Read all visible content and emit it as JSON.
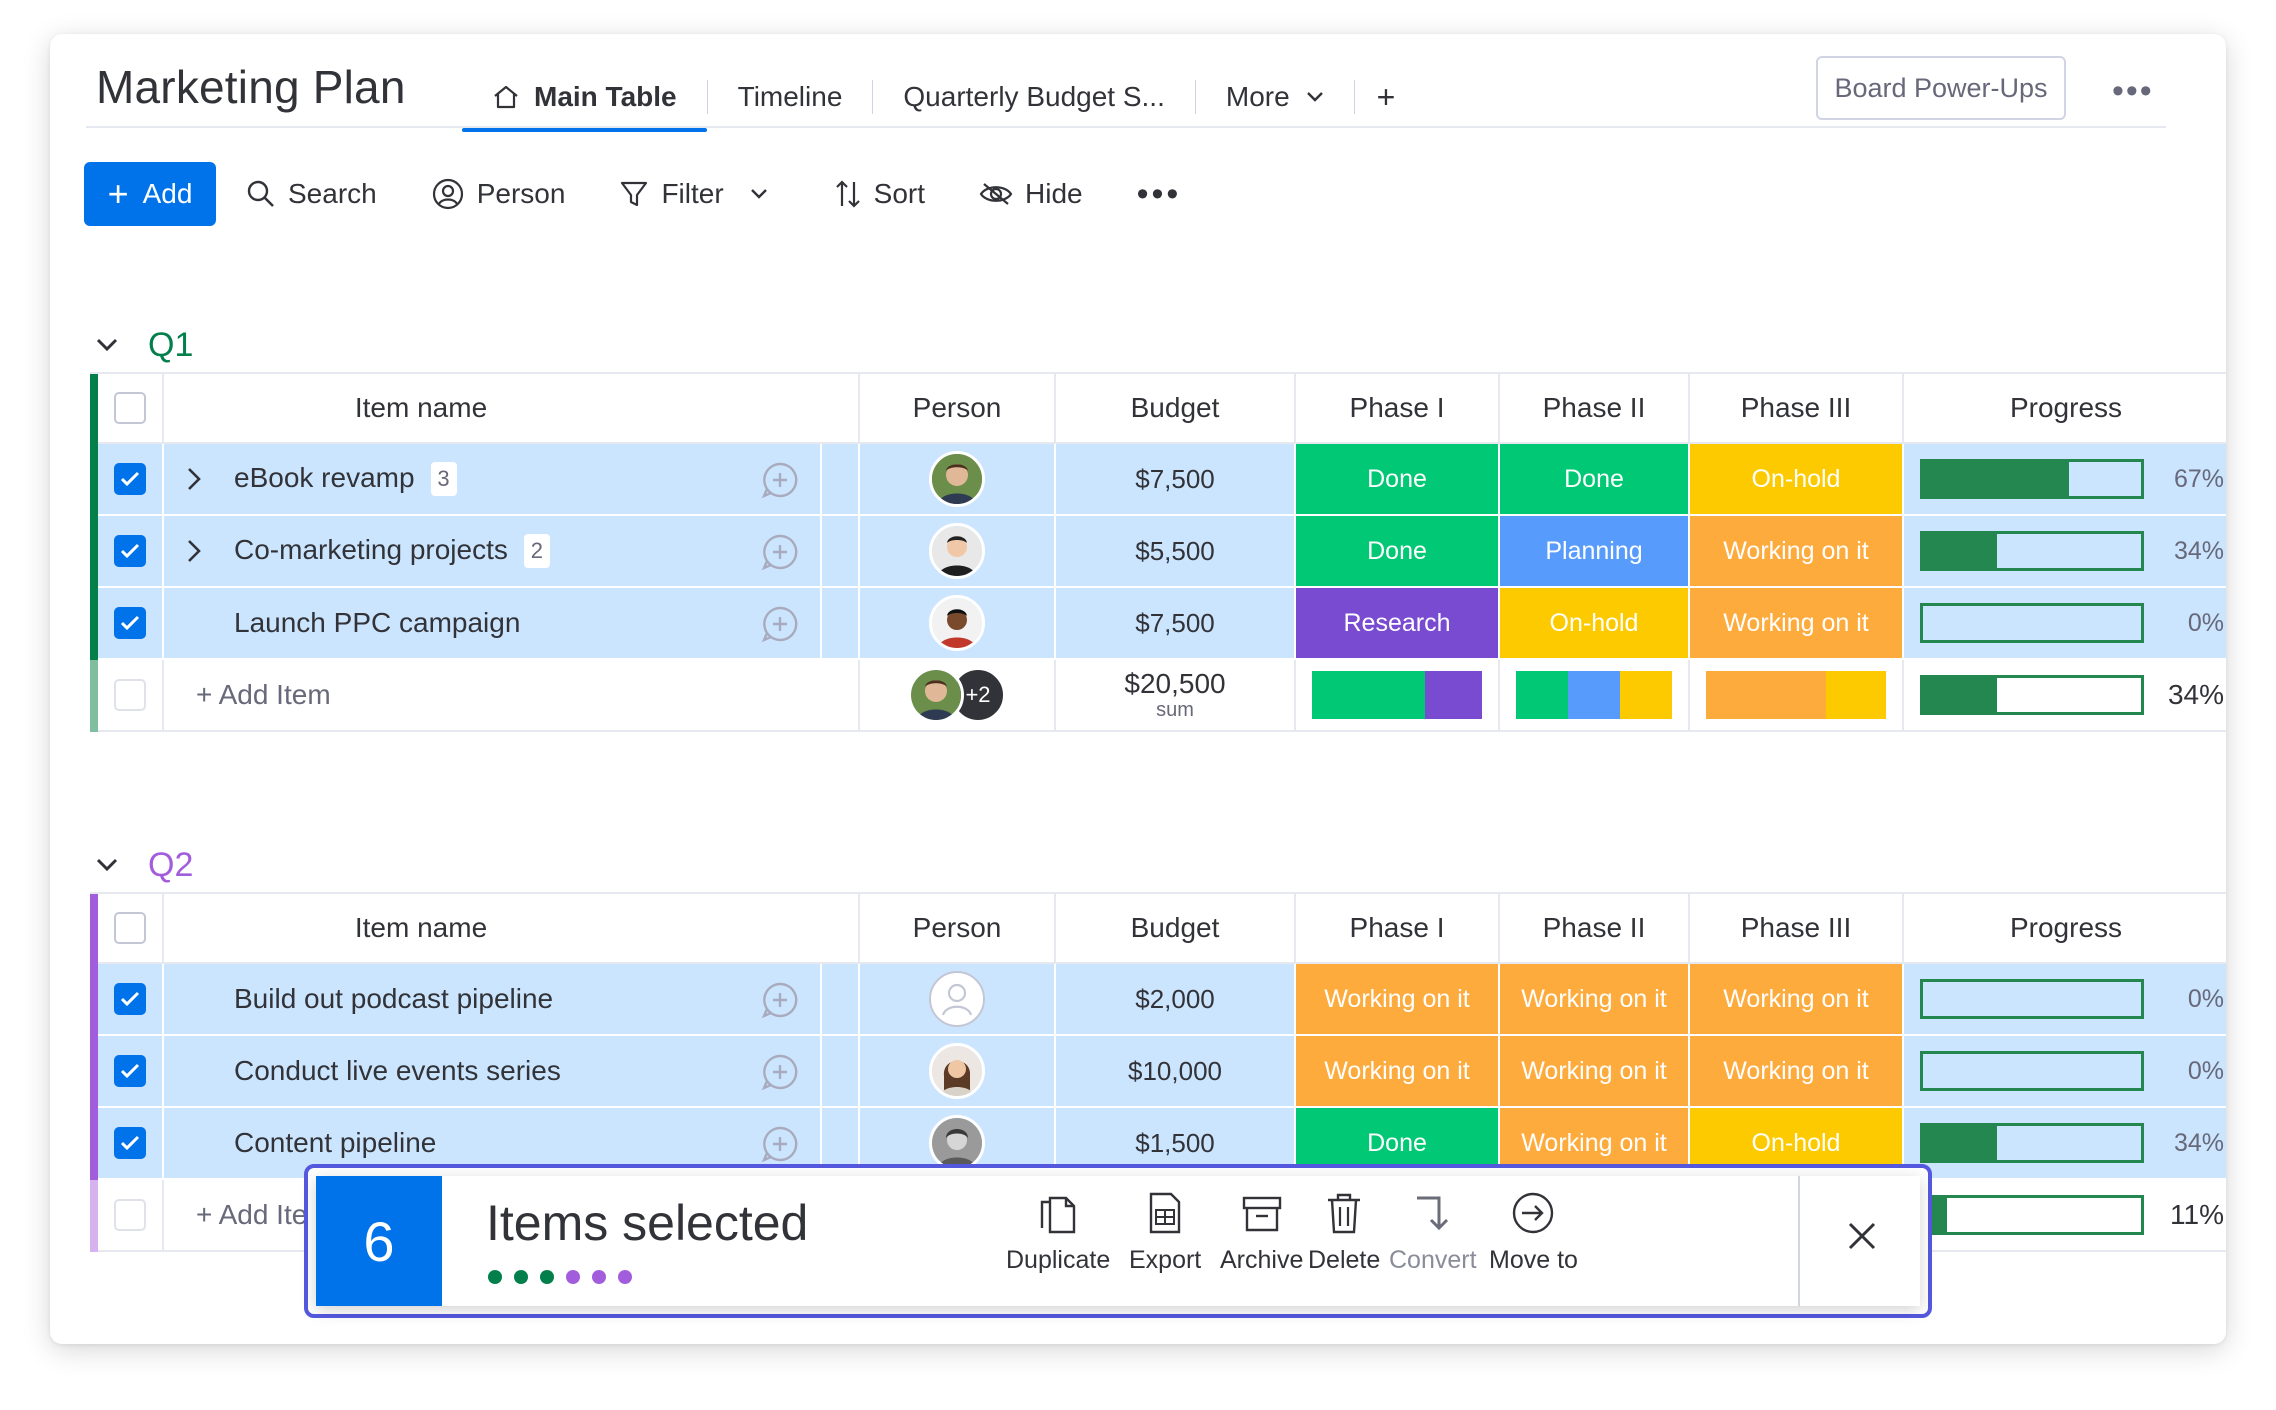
{
  "board": {
    "title": "Marketing Plan",
    "tabs": [
      {
        "label": "Main Table"
      },
      {
        "label": "Timeline"
      },
      {
        "label": "Quarterly Budget S..."
      },
      {
        "label": "More"
      }
    ],
    "add_tab": "+",
    "power_ups": "Board Power-Ups"
  },
  "toolbar": {
    "add": "Add",
    "search": "Search",
    "person": "Person",
    "filter": "Filter",
    "sort": "Sort",
    "hide": "Hide"
  },
  "columns": {
    "name": "Item name",
    "person": "Person",
    "budget": "Budget",
    "phase1": "Phase I",
    "phase2": "Phase II",
    "phase3": "Phase III",
    "progress": "Progress"
  },
  "colors": {
    "Done": "#00c875",
    "Planning": "#579bfc",
    "On-hold": "#fdca00",
    "Working on it": "#fdab3d",
    "Research": "#784bd1",
    "q1": "#037f4c",
    "q2": "#a25ddc",
    "accent": "#0073ea",
    "progress": "#258750"
  },
  "groups": [
    {
      "title": "Q1",
      "rows": [
        {
          "name": "eBook revamp",
          "subitems": "3",
          "budget": "$7,500",
          "phase1": "Done",
          "phase2": "Done",
          "phase3": "On-hold",
          "progress": 0.67,
          "progress_label": "67%"
        },
        {
          "name": "Co-marketing projects",
          "subitems": "2",
          "budget": "$5,500",
          "phase1": "Done",
          "phase2": "Planning",
          "phase3": "Working on it",
          "progress": 0.34,
          "progress_label": "34%"
        },
        {
          "name": "Launch PPC campaign",
          "subitems": "",
          "budget": "$7,500",
          "phase1": "Research",
          "phase2": "On-hold",
          "phase3": "Working on it",
          "progress": 0.0,
          "progress_label": "0%"
        }
      ],
      "summary": {
        "add_item": "+ Add Item",
        "extra_people": "+2",
        "budget": "$20,500",
        "budget_note": "sum",
        "progress": 0.34,
        "progress_label": "34%"
      }
    },
    {
      "title": "Q2",
      "rows": [
        {
          "name": "Build out podcast pipeline",
          "subitems": "",
          "budget": "$2,000",
          "phase1": "Working on it",
          "phase2": "Working on it",
          "phase3": "Working on it",
          "progress": 0.0,
          "progress_label": "0%"
        },
        {
          "name": "Conduct live events series",
          "subitems": "",
          "budget": "$10,000",
          "phase1": "Working on it",
          "phase2": "Working on it",
          "phase3": "Working on it",
          "progress": 0.0,
          "progress_label": "0%"
        },
        {
          "name": "Content pipeline",
          "subitems": "",
          "budget": "$1,500",
          "phase1": "Done",
          "phase2": "Working on it",
          "phase3": "On-hold",
          "progress": 0.34,
          "progress_label": "34%"
        }
      ],
      "summary": {
        "add_item": "+ Add Ite",
        "progress": 0.11,
        "progress_label": "11%"
      }
    }
  ],
  "selection": {
    "count": "6",
    "label": "Items selected",
    "actions": [
      {
        "label": "Duplicate"
      },
      {
        "label": "Export"
      },
      {
        "label": "Archive"
      },
      {
        "label": "Delete"
      },
      {
        "label": "Convert"
      },
      {
        "label": "Move to"
      }
    ]
  }
}
